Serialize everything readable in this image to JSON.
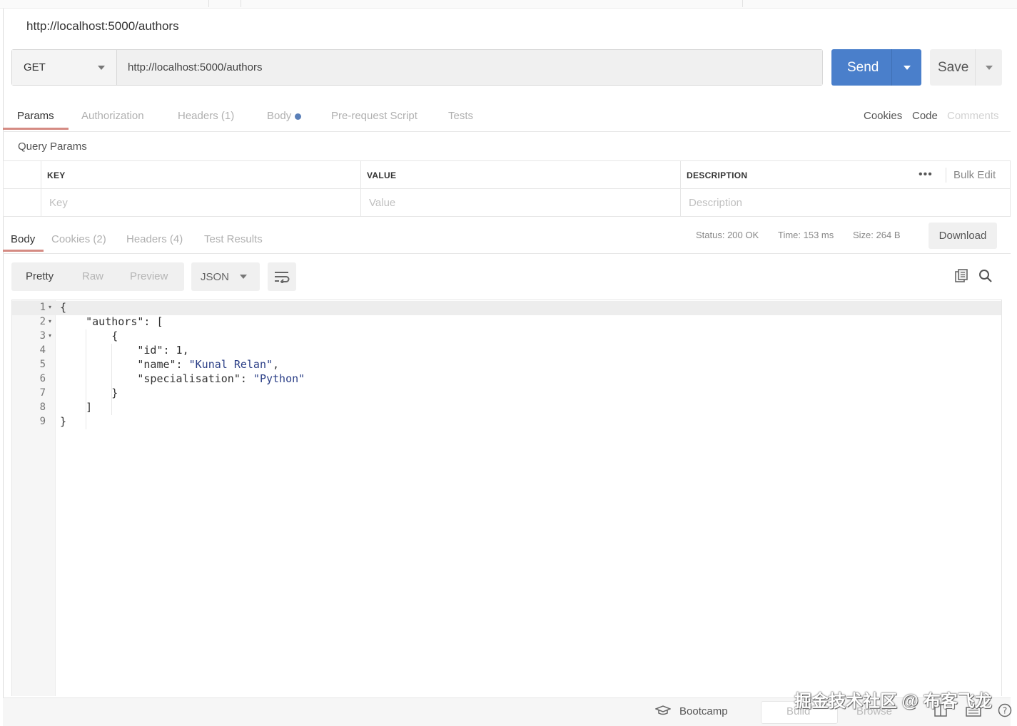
{
  "window": {
    "title_url": "http://localhost:5000/authors"
  },
  "request": {
    "method": "GET",
    "url": "http://localhost:5000/authors",
    "send_label": "Send",
    "save_label": "Save"
  },
  "request_tabs": {
    "params": "Params",
    "authorization": "Authorization",
    "headers": "Headers (1)",
    "body": "Body",
    "prerequest": "Pre-request Script",
    "tests": "Tests",
    "cookies": "Cookies",
    "code": "Code",
    "comments": "Comments"
  },
  "query_params": {
    "label": "Query Params",
    "headers": {
      "key": "KEY",
      "value": "VALUE",
      "description": "DESCRIPTION"
    },
    "placeholders": {
      "key": "Key",
      "value": "Value",
      "description": "Description"
    },
    "bulk_edit": "Bulk Edit"
  },
  "response_tabs": {
    "body": "Body",
    "cookies": "Cookies (2)",
    "headers": "Headers (4)",
    "test_results": "Test Results"
  },
  "response_meta": {
    "status": "Status: 200 OK",
    "time": "Time: 153 ms",
    "size": "Size: 264 B",
    "download": "Download"
  },
  "view": {
    "pretty": "Pretty",
    "raw": "Raw",
    "preview": "Preview",
    "format": "JSON"
  },
  "code_lines": [
    {
      "n": "1",
      "text": "{"
    },
    {
      "n": "2",
      "text": "    \"authors\": ["
    },
    {
      "n": "3",
      "text": "        {"
    },
    {
      "n": "4",
      "text": "            \"id\": 1,"
    },
    {
      "n": "5",
      "key": "            \"name\": ",
      "val": "\"Kunal Relan\"",
      "tail": ","
    },
    {
      "n": "6",
      "key": "            \"specialisation\": ",
      "val": "\"Python\"",
      "tail": ""
    },
    {
      "n": "7",
      "text": "        }"
    },
    {
      "n": "8",
      "text": "    ]"
    },
    {
      "n": "9",
      "text": "}"
    }
  ],
  "footer": {
    "bootcamp": "Bootcamp",
    "build": "Build",
    "browse": "Browse"
  },
  "watermark": "掘金技术社区 @ 布客飞龙",
  "colors": {
    "send": "#4a7fcb",
    "active_tab_underline": "#d58b83",
    "string_value": "#2a3e86"
  }
}
